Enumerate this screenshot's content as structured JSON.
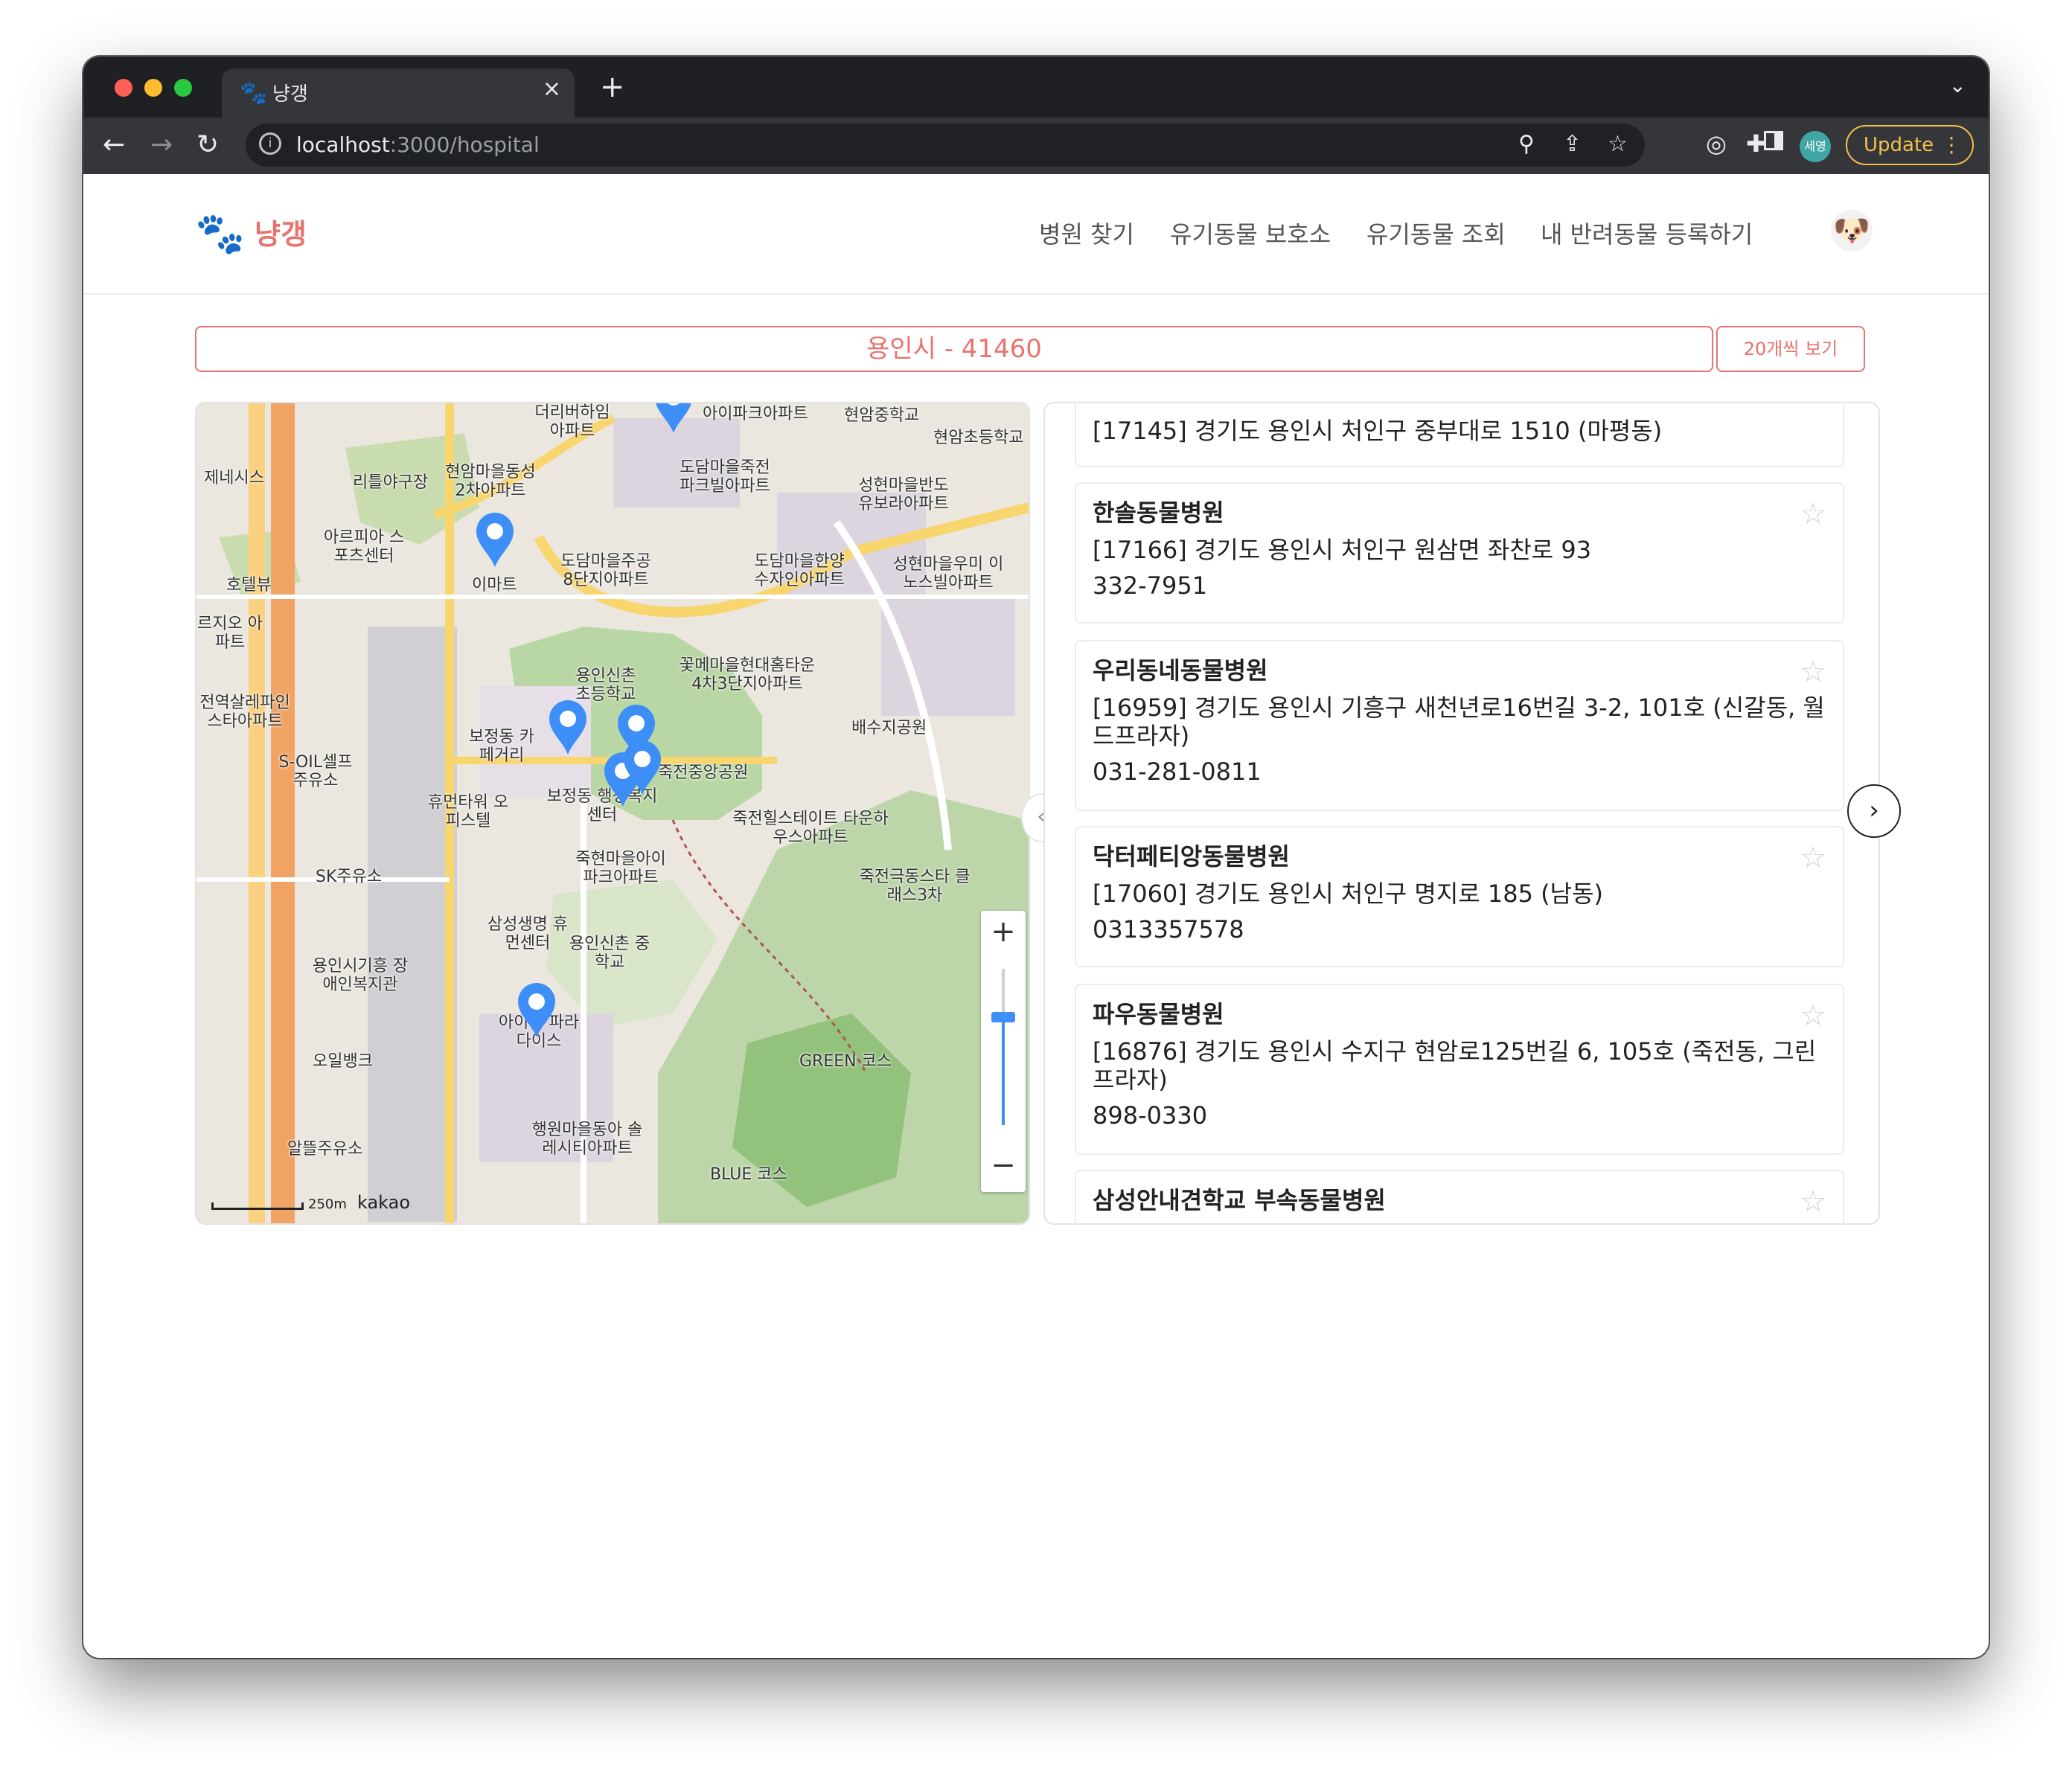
{
  "browser": {
    "tab_title": "냥갱",
    "tab_favicon": "🐾",
    "url_host": "localhost",
    "url_path": ":3000/hospital",
    "profile_label": "세영",
    "update_label": "Update"
  },
  "header": {
    "logo_icon": "paw-icon",
    "logo_text": "냥갱",
    "nav": [
      "병원 찾기",
      "유기동물 보호소",
      "유기동물 조회",
      "내 반려동물 등록하기"
    ]
  },
  "region": {
    "label": "용인시 - 41460",
    "view_button": "20개씩 보기"
  },
  "map": {
    "labels": [
      "제네시스",
      "리틀야구장",
      "현암마을동성 2차아파트",
      "더리버하임 아파트",
      "아이파크아파트",
      "현암중학교",
      "현암초등학교",
      "도담마을죽전 파크빌아파트",
      "성현마을반도 유보라아파트",
      "아르피아 스포츠센터",
      "호텔뷰",
      "이마트",
      "도담마을주공 8단지아파트",
      "도담마을한양 수자인아파트",
      "성현마을우미 이노스빌아파트",
      "르지오 아파트",
      "용인신촌 초등학교",
      "꽃메마을현대홈타운 4차3단지아파트",
      "전역살레파인 스타아파트",
      "보정동 카페거리",
      "배수지공원",
      "S-OIL셀프 주유소",
      "죽전중앙공원",
      "보정동 행정복지센터",
      "휴먼타워 오피스텔",
      "죽전힐스테이트 타운하우스아파트",
      "SK주유소",
      "죽현마을아이 파크아파트",
      "죽전극동스타 클래스3차",
      "삼성생명 휴먼센터",
      "용인신촌 중학교",
      "용인시기흥 장애인복지관",
      "아이리 파라다이스",
      "오일뱅크",
      "GREEN 코스",
      "행원마을동아 솔레시티아파트",
      "알뜰주유소",
      "BLUE 코스"
    ],
    "zoom_in": "+",
    "zoom_out": "−",
    "scale": "250m",
    "attribution": "kakao"
  },
  "hospitals": [
    {
      "name": "",
      "address": "[17145] 경기도 용인시 처인구 중부대로 1510 (마평동)",
      "phone": ""
    },
    {
      "name": "한솔동물병원",
      "address": "[17166] 경기도 용인시 처인구 원삼면 좌찬로 93",
      "phone": "332-7951"
    },
    {
      "name": "우리동네동물병원",
      "address": "[16959] 경기도 용인시 기흥구 새천년로16번길 3-2, 101호 (신갈동, 월드프라자)",
      "phone": "031-281-0811"
    },
    {
      "name": "닥터페티앙동물병원",
      "address": "[17060] 경기도 용인시 처인구 명지로 185 (남동)",
      "phone": "0313357578"
    },
    {
      "name": "파우동물병원",
      "address": "[16876] 경기도 용인시 수지구 현암로125번길 6, 105호 (죽전동, 그린프라자)",
      "phone": "898-0330"
    },
    {
      "name": "삼성안내견학교 부속동물병원",
      "address": "",
      "phone": ""
    }
  ],
  "carousel": {
    "prev": "‹",
    "next": "›"
  },
  "colors": {
    "brand": "#e8736f",
    "marker": "#3e8ef7",
    "update": "#f5c04a"
  }
}
